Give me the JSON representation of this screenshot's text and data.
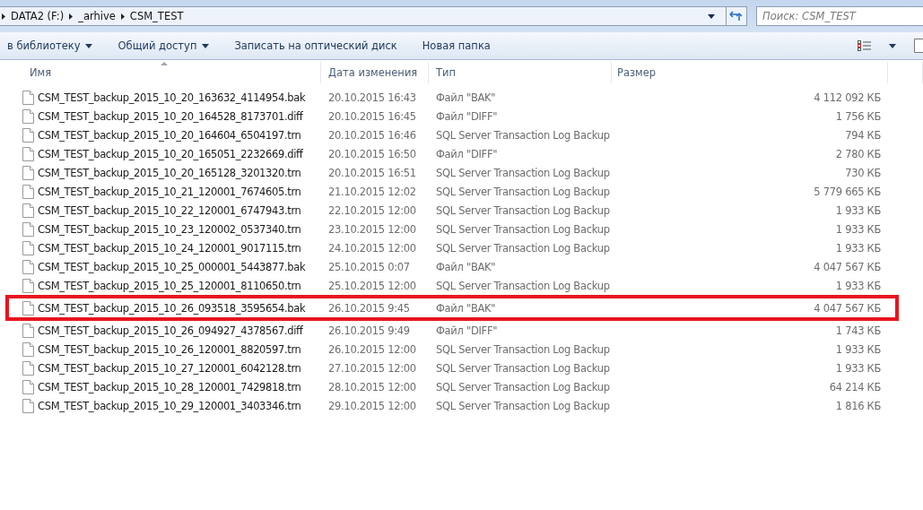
{
  "address_bar": {
    "breadcrumbs": [
      "DATA2 (F:)",
      "_arhive",
      "CSM_TEST"
    ]
  },
  "search": {
    "placeholder": "Поиск: CSM_TEST"
  },
  "toolbar": {
    "items": [
      {
        "label": "в библиотеку",
        "dropdown": true
      },
      {
        "label": "Общий доступ",
        "dropdown": true
      },
      {
        "label": "Записать на оптический диск",
        "dropdown": false
      },
      {
        "label": "Новая папка",
        "dropdown": false
      }
    ]
  },
  "table": {
    "columns": [
      {
        "label": "Имя",
        "sorted": true
      },
      {
        "label": "Дата изменения",
        "sorted": false
      },
      {
        "label": "Тип",
        "sorted": false
      },
      {
        "label": "Размер",
        "sorted": false
      }
    ],
    "rows": [
      {
        "name": "CSM_TEST_backup_2015_10_20_163632_4114954.bak",
        "date": "20.10.2015 16:43",
        "type": "Файл \"BAK\"",
        "size": "4 112 092 КБ",
        "highlighted": false
      },
      {
        "name": "CSM_TEST_backup_2015_10_20_164528_8173701.diff",
        "date": "20.10.2015 16:45",
        "type": "Файл \"DIFF\"",
        "size": "1 756 КБ",
        "highlighted": false
      },
      {
        "name": "CSM_TEST_backup_2015_10_20_164604_6504197.trn",
        "date": "20.10.2015 16:46",
        "type": "SQL Server Transaction Log Backup",
        "size": "794 КБ",
        "highlighted": false
      },
      {
        "name": "CSM_TEST_backup_2015_10_20_165051_2232669.diff",
        "date": "20.10.2015 16:50",
        "type": "Файл \"DIFF\"",
        "size": "2 780 КБ",
        "highlighted": false
      },
      {
        "name": "CSM_TEST_backup_2015_10_20_165128_3201320.trn",
        "date": "20.10.2015 16:51",
        "type": "SQL Server Transaction Log Backup",
        "size": "730 КБ",
        "highlighted": false
      },
      {
        "name": "CSM_TEST_backup_2015_10_21_120001_7674605.trn",
        "date": "21.10.2015 12:02",
        "type": "SQL Server Transaction Log Backup",
        "size": "5 779 665 КБ",
        "highlighted": false
      },
      {
        "name": "CSM_TEST_backup_2015_10_22_120001_6747943.trn",
        "date": "22.10.2015 12:00",
        "type": "SQL Server Transaction Log Backup",
        "size": "1 933 КБ",
        "highlighted": false
      },
      {
        "name": "CSM_TEST_backup_2015_10_23_120002_0537340.trn",
        "date": "23.10.2015 12:00",
        "type": "SQL Server Transaction Log Backup",
        "size": "1 933 КБ",
        "highlighted": false
      },
      {
        "name": "CSM_TEST_backup_2015_10_24_120001_9017115.trn",
        "date": "24.10.2015 12:00",
        "type": "SQL Server Transaction Log Backup",
        "size": "1 933 КБ",
        "highlighted": false
      },
      {
        "name": "CSM_TEST_backup_2015_10_25_000001_5443877.bak",
        "date": "25.10.2015 0:07",
        "type": "Файл \"BAK\"",
        "size": "4 047 567 КБ",
        "highlighted": false
      },
      {
        "name": "CSM_TEST_backup_2015_10_25_120001_8110650.trn",
        "date": "25.10.2015 12:00",
        "type": "SQL Server Transaction Log Backup",
        "size": "1 933 КБ",
        "highlighted": false
      },
      {
        "name": "CSM_TEST_backup_2015_10_26_093518_3595654.bak",
        "date": "26.10.2015 9:45",
        "type": "Файл \"BAK\"",
        "size": "4 047 567 КБ",
        "highlighted": true
      },
      {
        "name": "CSM_TEST_backup_2015_10_26_094927_4378567.diff",
        "date": "26.10.2015 9:49",
        "type": "Файл \"DIFF\"",
        "size": "1 743 КБ",
        "highlighted": false
      },
      {
        "name": "CSM_TEST_backup_2015_10_26_120001_8820597.trn",
        "date": "26.10.2015 12:00",
        "type": "SQL Server Transaction Log Backup",
        "size": "1 933 КБ",
        "highlighted": false
      },
      {
        "name": "CSM_TEST_backup_2015_10_27_120001_6042128.trn",
        "date": "27.10.2015 12:00",
        "type": "SQL Server Transaction Log Backup",
        "size": "1 933 КБ",
        "highlighted": false
      },
      {
        "name": "CSM_TEST_backup_2015_10_28_120001_7429818.trn",
        "date": "28.10.2015 12:00",
        "type": "SQL Server Transaction Log Backup",
        "size": "64 214 КБ",
        "highlighted": false
      },
      {
        "name": "CSM_TEST_backup_2015_10_29_120001_3403346.trn",
        "date": "29.10.2015 12:00",
        "type": "SQL Server Transaction Log Backup",
        "size": "1 816 КБ",
        "highlighted": false
      }
    ]
  }
}
